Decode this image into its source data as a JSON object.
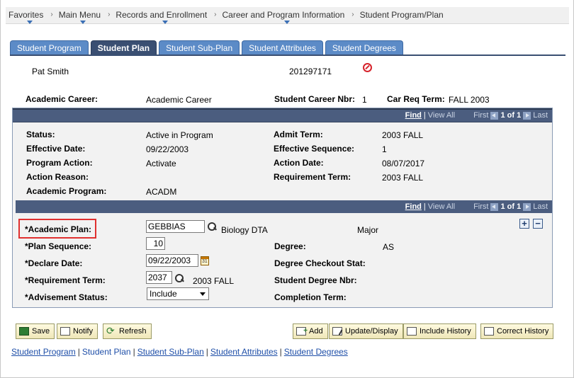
{
  "breadcrumb": [
    {
      "label": "Favorites",
      "dropdown": true
    },
    {
      "label": "Main Menu",
      "dropdown": true
    },
    {
      "label": "Records and Enrollment",
      "dropdown": true
    },
    {
      "label": "Career and Program Information",
      "dropdown": true
    },
    {
      "label": "Student Program/Plan",
      "dropdown": false
    }
  ],
  "tabs": [
    "Student Program",
    "Student Plan",
    "Student Sub-Plan",
    "Student Attributes",
    "Student Degrees"
  ],
  "active_tab": "Student Plan",
  "student": {
    "name": "Pat Smith",
    "id": "201297171"
  },
  "header": {
    "academic_career_label": "Academic Career:",
    "academic_career_value": "Academic Career",
    "career_nbr_label": "Student Career Nbr:",
    "career_nbr_value": "1",
    "car_req_term_label": "Car Req Term:",
    "car_req_term_value": "FALL 2003"
  },
  "nav": {
    "find": "Find",
    "view_all": "View All",
    "first": "First",
    "position": "1 of 1",
    "last": "Last",
    "sep": "|"
  },
  "program": {
    "status_label": "Status:",
    "status_value": "Active in Program",
    "effective_date_label": "Effective Date:",
    "effective_date_value": "09/22/2003",
    "program_action_label": "Program Action:",
    "program_action_value": "Activate",
    "action_reason_label": "Action Reason:",
    "academic_program_label": "Academic Program:",
    "academic_program_value": "ACADM",
    "admit_term_label": "Admit Term:",
    "admit_term_value": "2003 FALL",
    "effective_sequence_label": "Effective Sequence:",
    "effective_sequence_value": "1",
    "action_date_label": "Action Date:",
    "action_date_value": "08/07/2017",
    "requirement_term_label": "Requirement Term:",
    "requirement_term_value": "2003 FALL"
  },
  "plan": {
    "academic_plan_label": "*Academic Plan:",
    "academic_plan_value": "GEBBIAS",
    "academic_plan_desc": "Biology DTA",
    "plan_type": "Major",
    "plan_sequence_label": "*Plan Sequence:",
    "plan_sequence_value": "10",
    "declare_date_label": "*Declare Date:",
    "declare_date_value": "09/22/2003",
    "requirement_term_label": "*Requirement Term:",
    "requirement_term_value": "2037",
    "requirement_term_desc": "2003 FALL",
    "advisement_status_label": "*Advisement Status:",
    "advisement_status_value": "Include",
    "degree_label": "Degree:",
    "degree_value": "AS",
    "degree_checkout_label": "Degree Checkout Stat:",
    "student_degree_nbr_label": "Student Degree Nbr:",
    "completion_term_label": "Completion Term:",
    "add_row": "+",
    "delete_row": "−"
  },
  "buttons": {
    "save": "Save",
    "notify": "Notify",
    "refresh": "Refresh",
    "add": "Add",
    "update_display": "Update/Display",
    "include_history": "Include History",
    "correct_history": "Correct History"
  },
  "bottom_links": [
    "Student Program",
    "Student Plan",
    "Student Sub-Plan",
    "Student Attributes",
    "Student Degrees"
  ],
  "colors": {
    "tab": "#5c8bc7",
    "tab_active": "#3a4f72",
    "navbar": "#4b5d7f",
    "highlight": "#e0302f",
    "link": "#1f4fa8"
  }
}
